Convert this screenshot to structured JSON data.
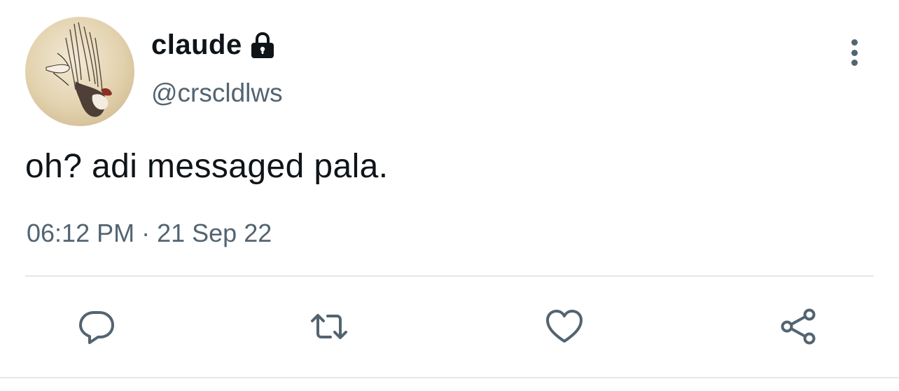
{
  "author": {
    "display_name": "claude",
    "handle": "@crscldlws",
    "protected_icon": "lock-icon",
    "avatar": "illustrated-avatar"
  },
  "tweet": {
    "text": "oh? adi messaged pala.",
    "time": "06:12 PM",
    "separator": "·",
    "date": "21 Sep 22"
  },
  "actions": {
    "reply_icon": "speech-bubble-icon",
    "retweet_icon": "retweet-icon",
    "like_icon": "heart-icon",
    "share_icon": "share-icon",
    "more_icon": "vertical-ellipsis-icon"
  },
  "colors": {
    "text_primary": "#0f1419",
    "text_secondary": "#536471",
    "divider": "#e4e8eb",
    "background": "#ffffff"
  }
}
